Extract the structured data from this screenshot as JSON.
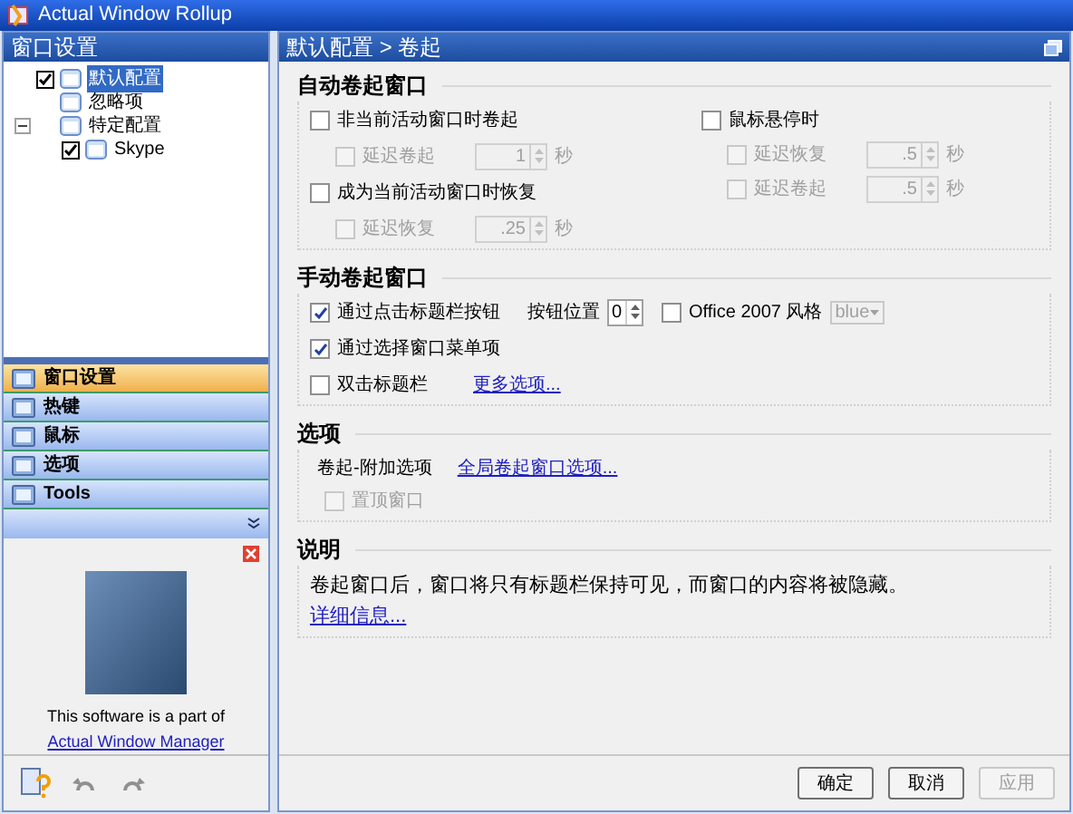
{
  "window": {
    "title": "Actual Window Rollup"
  },
  "sidebar": {
    "header": "窗口设置",
    "tree": [
      {
        "label": "默认配置",
        "checked": true,
        "selected": true
      },
      {
        "label": "忽略项",
        "selected": false
      },
      {
        "label": "特定配置",
        "selected": false,
        "expanded": true,
        "children": [
          {
            "label": "Skype",
            "checked": true,
            "selected": false
          }
        ]
      }
    ],
    "nav": [
      {
        "label": "窗口设置",
        "selected": true
      },
      {
        "label": "热键",
        "selected": false
      },
      {
        "label": "鼠标",
        "selected": false
      },
      {
        "label": "选项",
        "selected": false
      },
      {
        "label": "Tools",
        "selected": false
      }
    ],
    "promo": {
      "text": "This software is a part of",
      "link": "Actual Window Manager"
    }
  },
  "panel": {
    "breadcrumb": "默认配置 > 卷起",
    "auto": {
      "title": "自动卷起窗口",
      "inactive": {
        "label": "非当前活动窗口时卷起",
        "checked": false,
        "disabled": false
      },
      "inactive_delay": {
        "label": "延迟卷起",
        "checked": false,
        "disabled": true,
        "value": "1",
        "unit": "秒"
      },
      "active": {
        "label": "成为当前活动窗口时恢复",
        "checked": false,
        "disabled": false
      },
      "active_delay": {
        "label": "延迟恢复",
        "checked": false,
        "disabled": true,
        "value": ".25",
        "unit": "秒"
      },
      "hover": {
        "label": "鼠标悬停时",
        "checked": false,
        "disabled": false
      },
      "hover_delays": [
        {
          "label": "延迟恢复",
          "checked": false,
          "disabled": true,
          "value": ".5",
          "unit": "秒"
        },
        {
          "label": "延迟卷起",
          "checked": false,
          "disabled": true,
          "value": ".5",
          "unit": "秒"
        }
      ]
    },
    "manual": {
      "title": "手动卷起窗口",
      "title_button": {
        "label": "通过点击标题栏按钮",
        "checked": true,
        "disabled": false
      },
      "position": {
        "label": "按钮位置",
        "value": "0"
      },
      "office": {
        "label": "Office 2007 风格",
        "checked": false,
        "disabled": false
      },
      "style": {
        "value": "blue",
        "disabled": true
      },
      "menu_item": {
        "label": "通过选择窗口菜单项",
        "checked": true,
        "disabled": false
      },
      "double_click": {
        "label": "双击标题栏",
        "checked": false,
        "disabled": false
      },
      "more": "更多选项..."
    },
    "options": {
      "title": "选项",
      "label": "卷起-附加选项",
      "link": "全局卷起窗口选项...",
      "topmost": {
        "label": "置顶窗口",
        "checked": false,
        "disabled": true
      }
    },
    "about": {
      "title": "说明",
      "text": "卷起窗口后，窗口将只有标题栏保持可见，而窗口的内容将被隐藏。",
      "link": "详细信息..."
    },
    "buttons": [
      {
        "label": "确定",
        "disabled": false
      },
      {
        "label": "取消",
        "disabled": false
      },
      {
        "label": "应用",
        "disabled": true
      }
    ]
  }
}
